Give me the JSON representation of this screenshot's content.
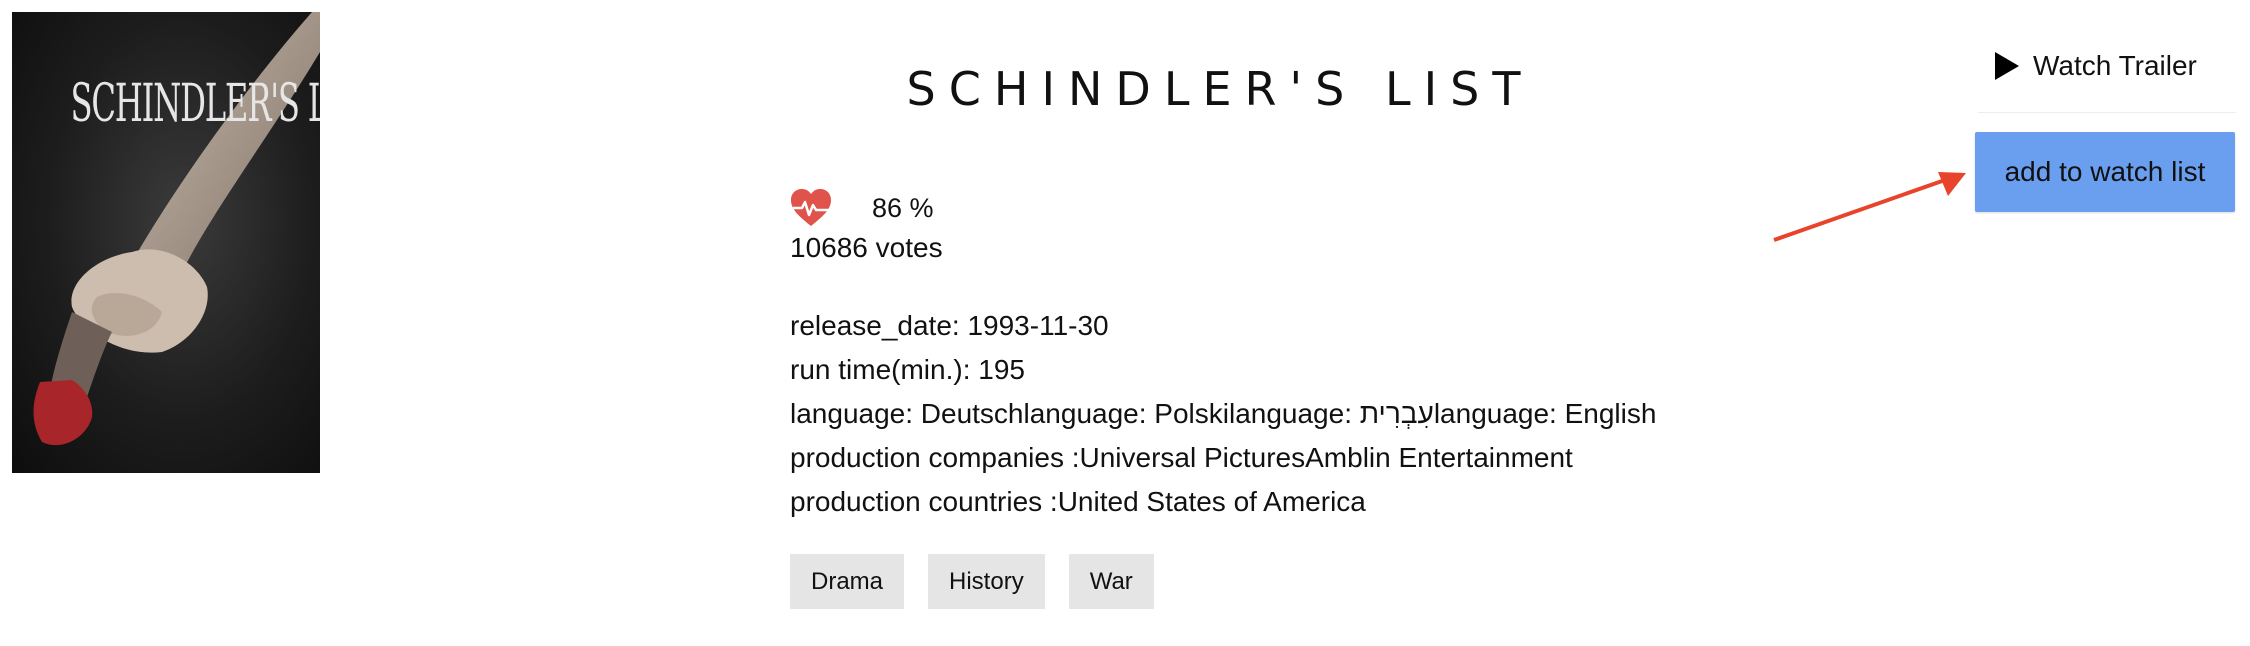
{
  "movie": {
    "title": "SCHINDLER'S LIST",
    "poster_text": "SCHINDLER'S LIST",
    "rating": "86 %",
    "votes": "10686 votes",
    "release_date": "release_date: 1993-11-30",
    "runtime": "run time(min.): 195",
    "languages": "language: Deutschlanguage: Polskilanguage: עִבְרִיתlanguage: English",
    "production_companies": "production companies :Universal PicturesAmblin Entertainment",
    "production_countries": "production countries :United States of America",
    "genres": [
      "Drama",
      "History",
      "War"
    ]
  },
  "actions": {
    "watch_trailer": "Watch Trailer",
    "add_to_watchlist": "add to watch list"
  },
  "icons": {
    "rating": "heart-pulse-icon",
    "trailer": "play-icon"
  },
  "colors": {
    "button": "#6a9ff0",
    "heart": "#e0534b",
    "annotation_arrow": "#e8442c",
    "genre_tag": "#e5e5e5"
  }
}
